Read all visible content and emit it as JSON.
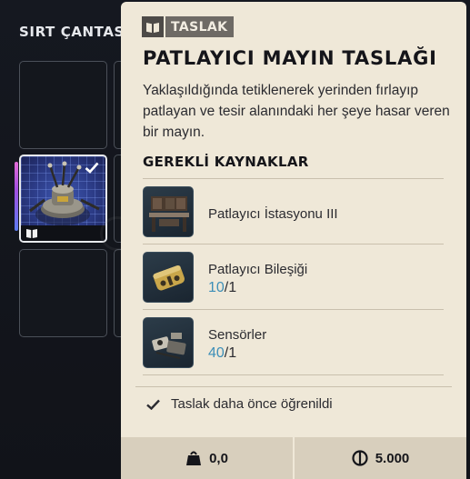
{
  "backpack": {
    "title": "SIRT ÇANTASI"
  },
  "tooltip": {
    "badge_label": "TASLAK",
    "title": "PATLAYICI MAYIN TASLAĞI",
    "description": "Yaklaşıldığında tetiklenerek yerinden fırlayıp patlayan ve tesir alanındaki her şeye hasar veren bir mayın.",
    "requirements_title": "GEREKLİ KAYNAKLAR",
    "resources": [
      {
        "name": "Patlayıcı İstasyonu III",
        "icon": "workbench-icon"
      },
      {
        "name": "Patlayıcı Bileşiği",
        "have": "10",
        "need": "/1",
        "icon": "explosive-compound-icon"
      },
      {
        "name": "Sensörler",
        "have": "40",
        "need": "/1",
        "icon": "sensors-icon"
      }
    ],
    "learned_text": "Taslak daha önce öğrenildi",
    "weight": "0,0",
    "price": "5.000"
  },
  "colors": {
    "tooltip_bg": "#efe8d8",
    "footer_bg": "#d8cfbd",
    "quantity_have": "#3d8fb8",
    "badge_bg": "#6e6a65"
  }
}
